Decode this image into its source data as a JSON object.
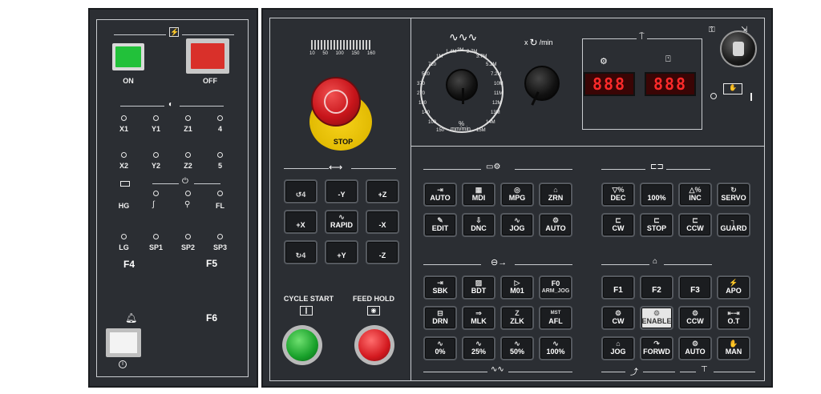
{
  "left_panel": {
    "power_icon": "lightning-icon",
    "on_label": "ON",
    "off_label": "OFF",
    "axis_icon": "axis-selector-icon",
    "axes_row1": [
      "X1",
      "Y1",
      "Z1",
      "4"
    ],
    "axes_row2": [
      "X2",
      "Y2",
      "Z2",
      "5"
    ],
    "hg_label": "HG",
    "fl_label": "FL",
    "row4": [
      "LG",
      "SP1",
      "SP2",
      "SP3"
    ],
    "f4": "F4",
    "f5": "F5",
    "f6": "F6"
  },
  "spindle_bar": {
    "scale": [
      "10",
      "50",
      "100",
      "150",
      "160"
    ]
  },
  "estop_label": "STOP",
  "feed_dial": {
    "unit": "%",
    "unit2": "mm/min",
    "labels": [
      "1.4M",
      "2M",
      "2.7M",
      "1M",
      "3.7M",
      "720",
      "5.2M",
      "520",
      "7.2M",
      "370",
      "10M",
      "270",
      "11M",
      "180",
      "12M",
      "140",
      "13M",
      "100",
      "14M",
      "150",
      "15M"
    ]
  },
  "spindle_dial": {
    "unit": "x",
    "unit2": "/min"
  },
  "displays": {
    "left": "888",
    "right": "888"
  },
  "mode_keys": [
    {
      "label": "AUTO",
      "icon": "⇥"
    },
    {
      "label": "MDI",
      "icon": "▦"
    },
    {
      "label": "MPG",
      "icon": "◎"
    },
    {
      "label": "ZRN",
      "icon": "⌂"
    },
    {
      "label": "EDIT",
      "icon": "✎"
    },
    {
      "label": "DNC",
      "icon": "⇩"
    },
    {
      "label": "JOG",
      "icon": "∿"
    },
    {
      "label": "AUTO",
      "icon": "⚙"
    }
  ],
  "spindle_keys": [
    {
      "label": "DEC",
      "icon": "▽%"
    },
    {
      "label": "100%",
      "icon": ""
    },
    {
      "label": "INC",
      "icon": "△%"
    },
    {
      "label": "SERVO",
      "icon": "↻"
    },
    {
      "label": "CW",
      "icon": "⊏"
    },
    {
      "label": "STOP",
      "icon": "⊏"
    },
    {
      "label": "CCW",
      "icon": "⊏"
    },
    {
      "label": "GUARD",
      "icon": "┐"
    }
  ],
  "jog_keys": [
    {
      "label": "",
      "icon": "↺4"
    },
    {
      "label": "-Y",
      "icon": ""
    },
    {
      "label": "+Z",
      "icon": ""
    },
    {
      "label": "+X",
      "icon": ""
    },
    {
      "label": "RAPID",
      "icon": "∿"
    },
    {
      "label": "-X",
      "icon": ""
    },
    {
      "label": "",
      "icon": "↻4"
    },
    {
      "label": "+Y",
      "icon": ""
    },
    {
      "label": "-Z",
      "icon": ""
    }
  ],
  "cycle_start": "CYCLE START",
  "feed_hold": "FEED HOLD",
  "program_keys": [
    {
      "label": "SBK",
      "icon": "⇥"
    },
    {
      "label": "BDT",
      "icon": "▨"
    },
    {
      "label": "M01",
      "icon": "▷"
    },
    {
      "label": "F0",
      "icon": "ARM_JOG"
    },
    {
      "label": "DRN",
      "icon": "⊟"
    },
    {
      "label": "MLK",
      "icon": "⇒"
    },
    {
      "label": "ZLK",
      "icon": "Z"
    },
    {
      "label": "AFL",
      "icon": "MST"
    },
    {
      "label": "0%",
      "icon": "∿"
    },
    {
      "label": "25%",
      "icon": "∿"
    },
    {
      "label": "50%",
      "icon": "∿"
    },
    {
      "label": "100%",
      "icon": "∿"
    }
  ],
  "aux_keys": [
    {
      "label": "F1",
      "icon": ""
    },
    {
      "label": "F2",
      "icon": ""
    },
    {
      "label": "F3",
      "icon": ""
    },
    {
      "label": "APO",
      "icon": "⚡"
    },
    {
      "label": "CW",
      "icon": "⚙"
    },
    {
      "label": "ENABLE",
      "icon": "⚙"
    },
    {
      "label": "CCW",
      "icon": "⚙"
    },
    {
      "label": "O.T",
      "icon": "⇤⇥"
    },
    {
      "label": "JOG",
      "icon": "⌂"
    },
    {
      "label": "FORWD",
      "icon": "↷"
    },
    {
      "label": "AUTO",
      "icon": "⚙"
    },
    {
      "label": "MAN",
      "icon": "✋"
    }
  ]
}
